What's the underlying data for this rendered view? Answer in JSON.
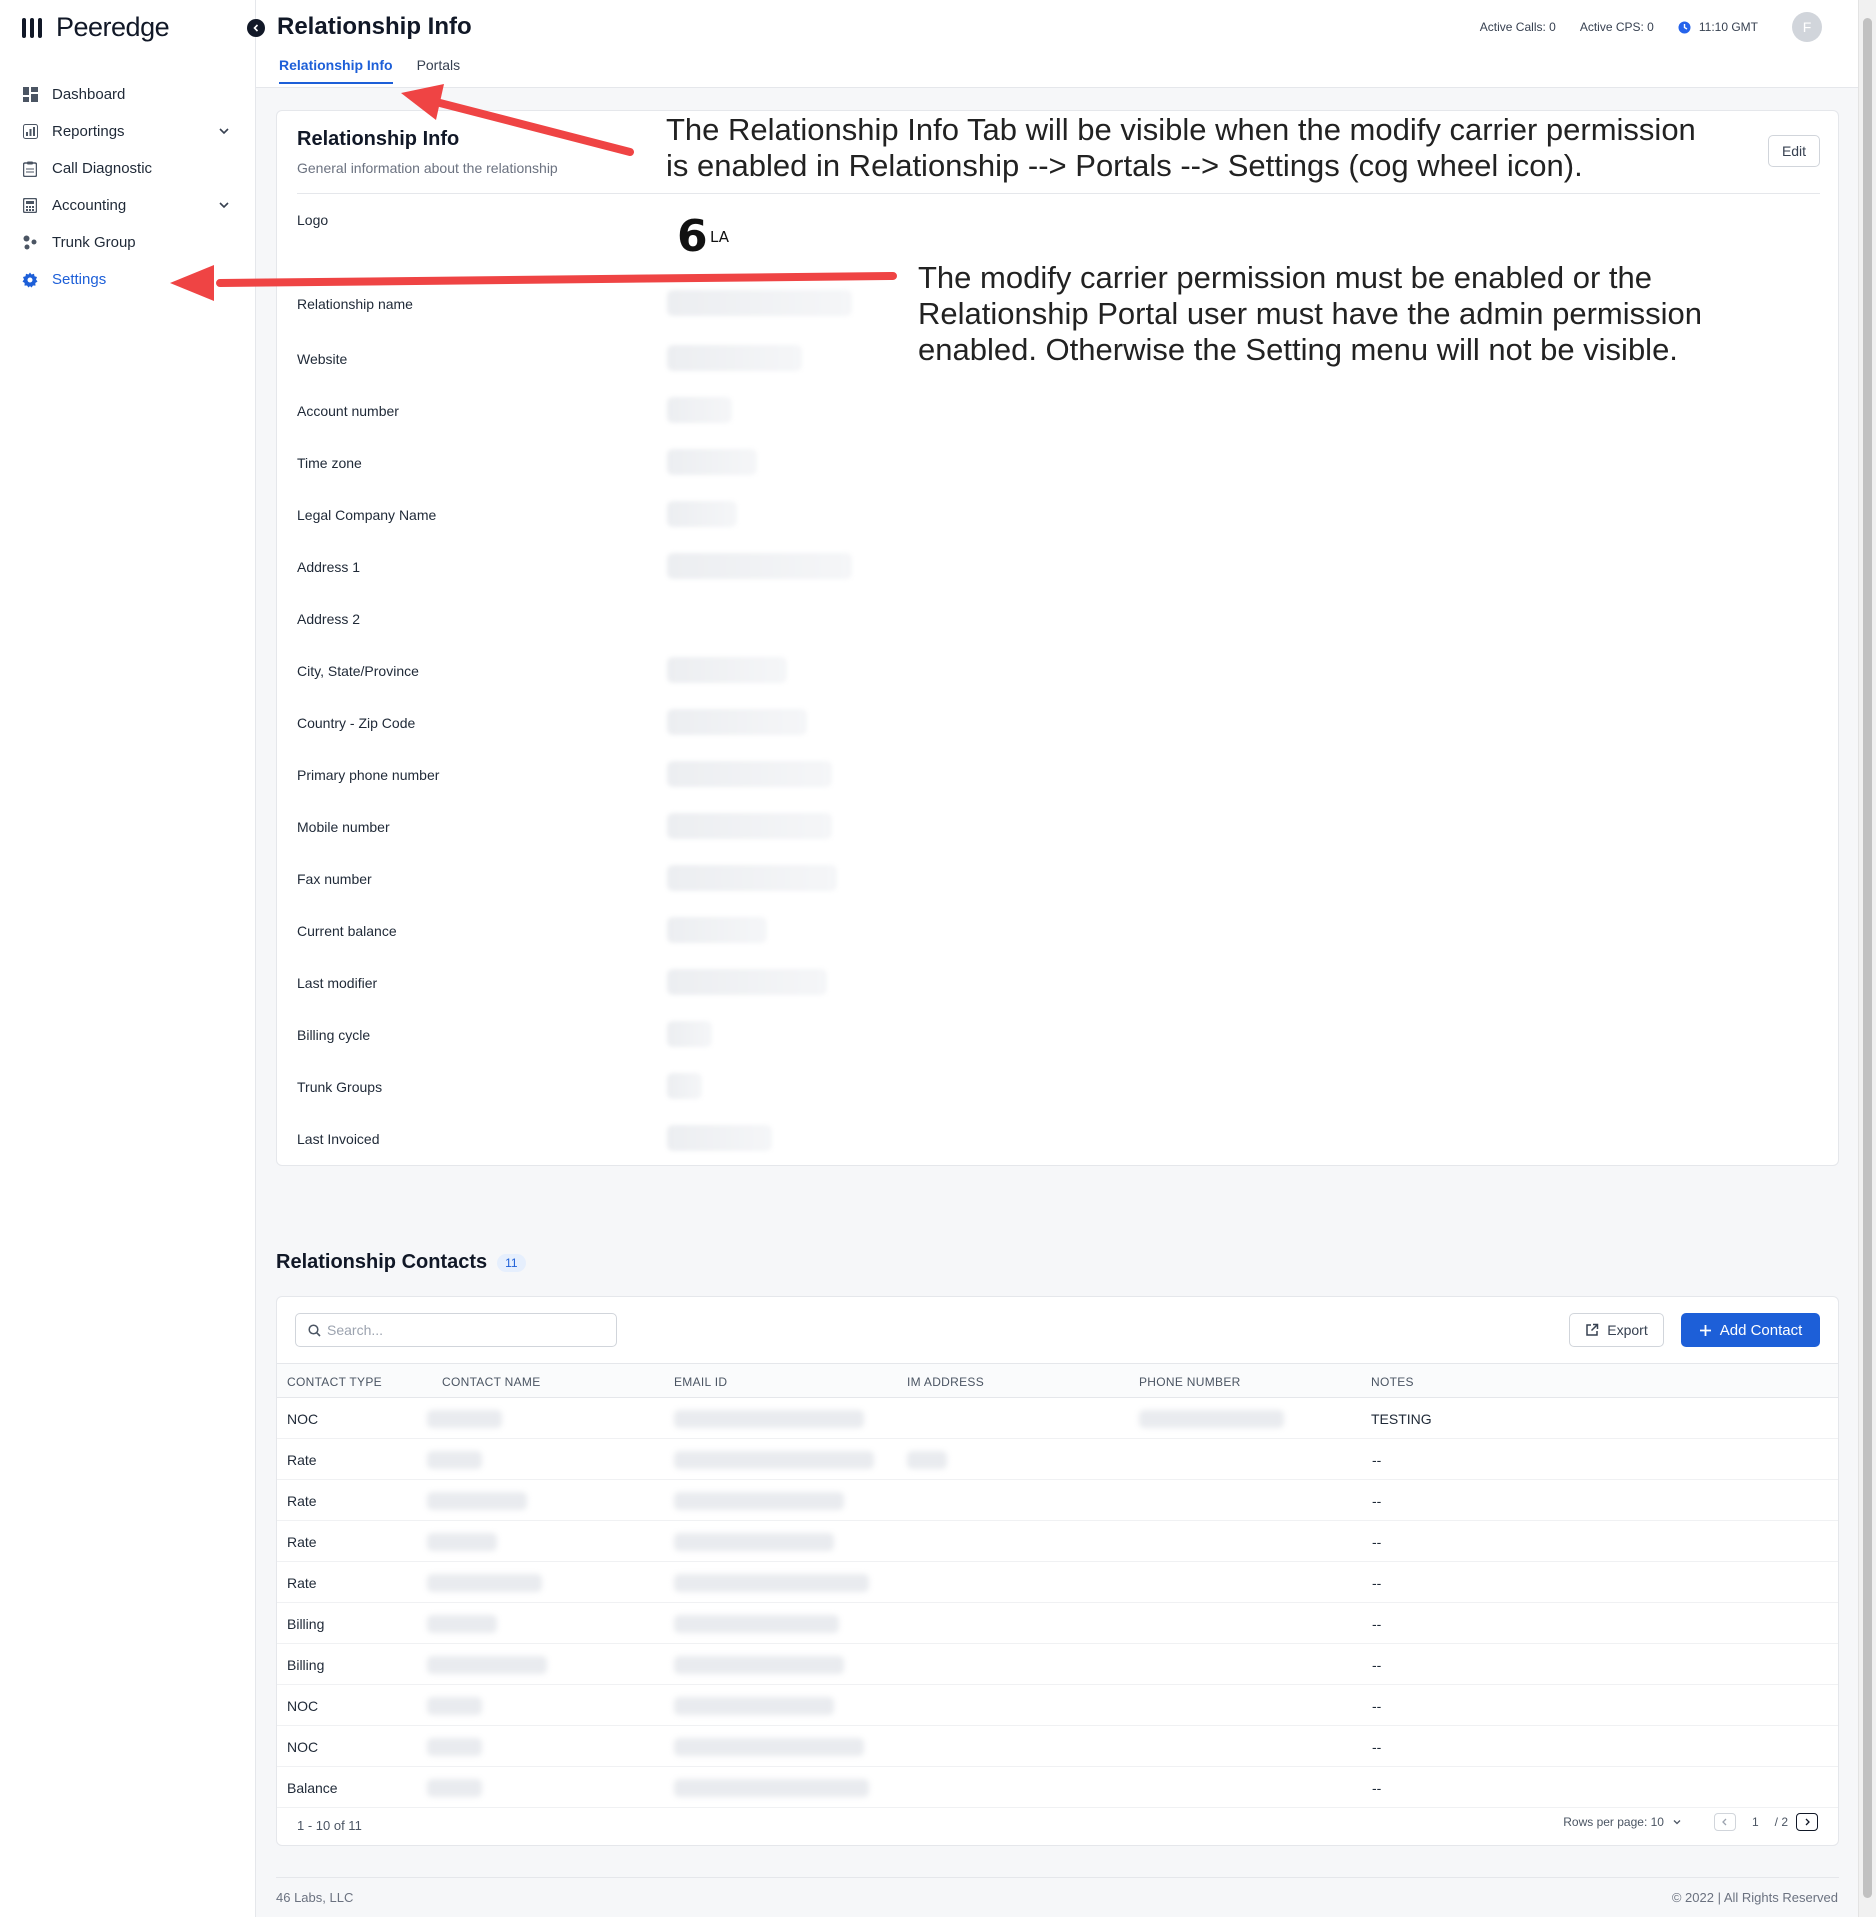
{
  "app": {
    "brand": "Peeredge"
  },
  "sidebar": {
    "items": [
      {
        "label": "Dashboard",
        "icon": "dashboard-icon",
        "active": false,
        "expandable": false
      },
      {
        "label": "Reportings",
        "icon": "report-icon",
        "active": false,
        "expandable": true
      },
      {
        "label": "Call Diagnostic",
        "icon": "clipboard-icon",
        "active": false,
        "expandable": false
      },
      {
        "label": "Accounting",
        "icon": "calculator-icon",
        "active": false,
        "expandable": true
      },
      {
        "label": "Trunk Group",
        "icon": "trunk-icon",
        "active": false,
        "expandable": false
      },
      {
        "label": "Settings",
        "icon": "gear-icon",
        "active": true,
        "expandable": false
      }
    ]
  },
  "header": {
    "title": "Relationship Info",
    "tabs": [
      {
        "label": "Relationship Info",
        "active": true
      },
      {
        "label": "Portals",
        "active": false
      }
    ],
    "active_calls": "Active Calls: 0",
    "active_cps": "Active CPS: 0",
    "time": "11:10 GMT",
    "avatar_initial": "F"
  },
  "info_card": {
    "title": "Relationship Info",
    "subtitle": "General information about the relationship",
    "edit_label": "Edit",
    "logo_mark": "6",
    "logo_text": "LA",
    "fields": [
      {
        "label": "Logo"
      },
      {
        "label": "Relationship name"
      },
      {
        "label": "Website"
      },
      {
        "label": "Account number"
      },
      {
        "label": "Time zone"
      },
      {
        "label": "Legal Company Name"
      },
      {
        "label": "Address 1"
      },
      {
        "label": "Address 2"
      },
      {
        "label": "City, State/Province"
      },
      {
        "label": "Country - Zip Code"
      },
      {
        "label": "Primary phone number"
      },
      {
        "label": "Mobile number"
      },
      {
        "label": "Fax number"
      },
      {
        "label": "Current balance"
      },
      {
        "label": "Last modifier"
      },
      {
        "label": "Billing cycle"
      },
      {
        "label": "Trunk Groups"
      },
      {
        "label": "Last Invoiced"
      }
    ]
  },
  "contacts": {
    "title": "Relationship Contacts",
    "count": "11",
    "search_placeholder": "Search...",
    "export_label": "Export",
    "add_label": "Add Contact",
    "columns": [
      "CONTACT TYPE",
      "CONTACT NAME",
      "EMAIL ID",
      "IM ADDRESS",
      "PHONE NUMBER",
      "NOTES"
    ],
    "rows": [
      {
        "type": "NOC",
        "notes": "TESTING"
      },
      {
        "type": "Rate",
        "notes": "--"
      },
      {
        "type": "Rate",
        "notes": "--"
      },
      {
        "type": "Rate",
        "notes": "--"
      },
      {
        "type": "Rate",
        "notes": "--"
      },
      {
        "type": "Billing",
        "notes": "--"
      },
      {
        "type": "Billing",
        "notes": "--"
      },
      {
        "type": "NOC",
        "notes": "--"
      },
      {
        "type": "NOC",
        "notes": "--"
      },
      {
        "type": "Balance",
        "notes": "--"
      }
    ],
    "range_text": "1 - 10 of 11",
    "rows_per_page": "Rows per page: 10",
    "current_page": "1",
    "total_pages": "/ 2"
  },
  "footer": {
    "company": "46 Labs, LLC",
    "copyright": "© 2022 | All Rights Reserved"
  },
  "annotations": {
    "tab_note": [
      "The Relationship Info Tab will be visible when the modify carrier permission",
      "is enabled in Relationship --> Portals --> Settings (cog wheel icon)."
    ],
    "settings_note": [
      "The modify carrier permission must be enabled or the",
      "Relationship Portal user must have the admin permission",
      "enabled. Otherwise the Setting menu will not be visible."
    ]
  },
  "colors": {
    "accent": "#1d5fd8",
    "annotation_arrow": "#ef4444"
  }
}
